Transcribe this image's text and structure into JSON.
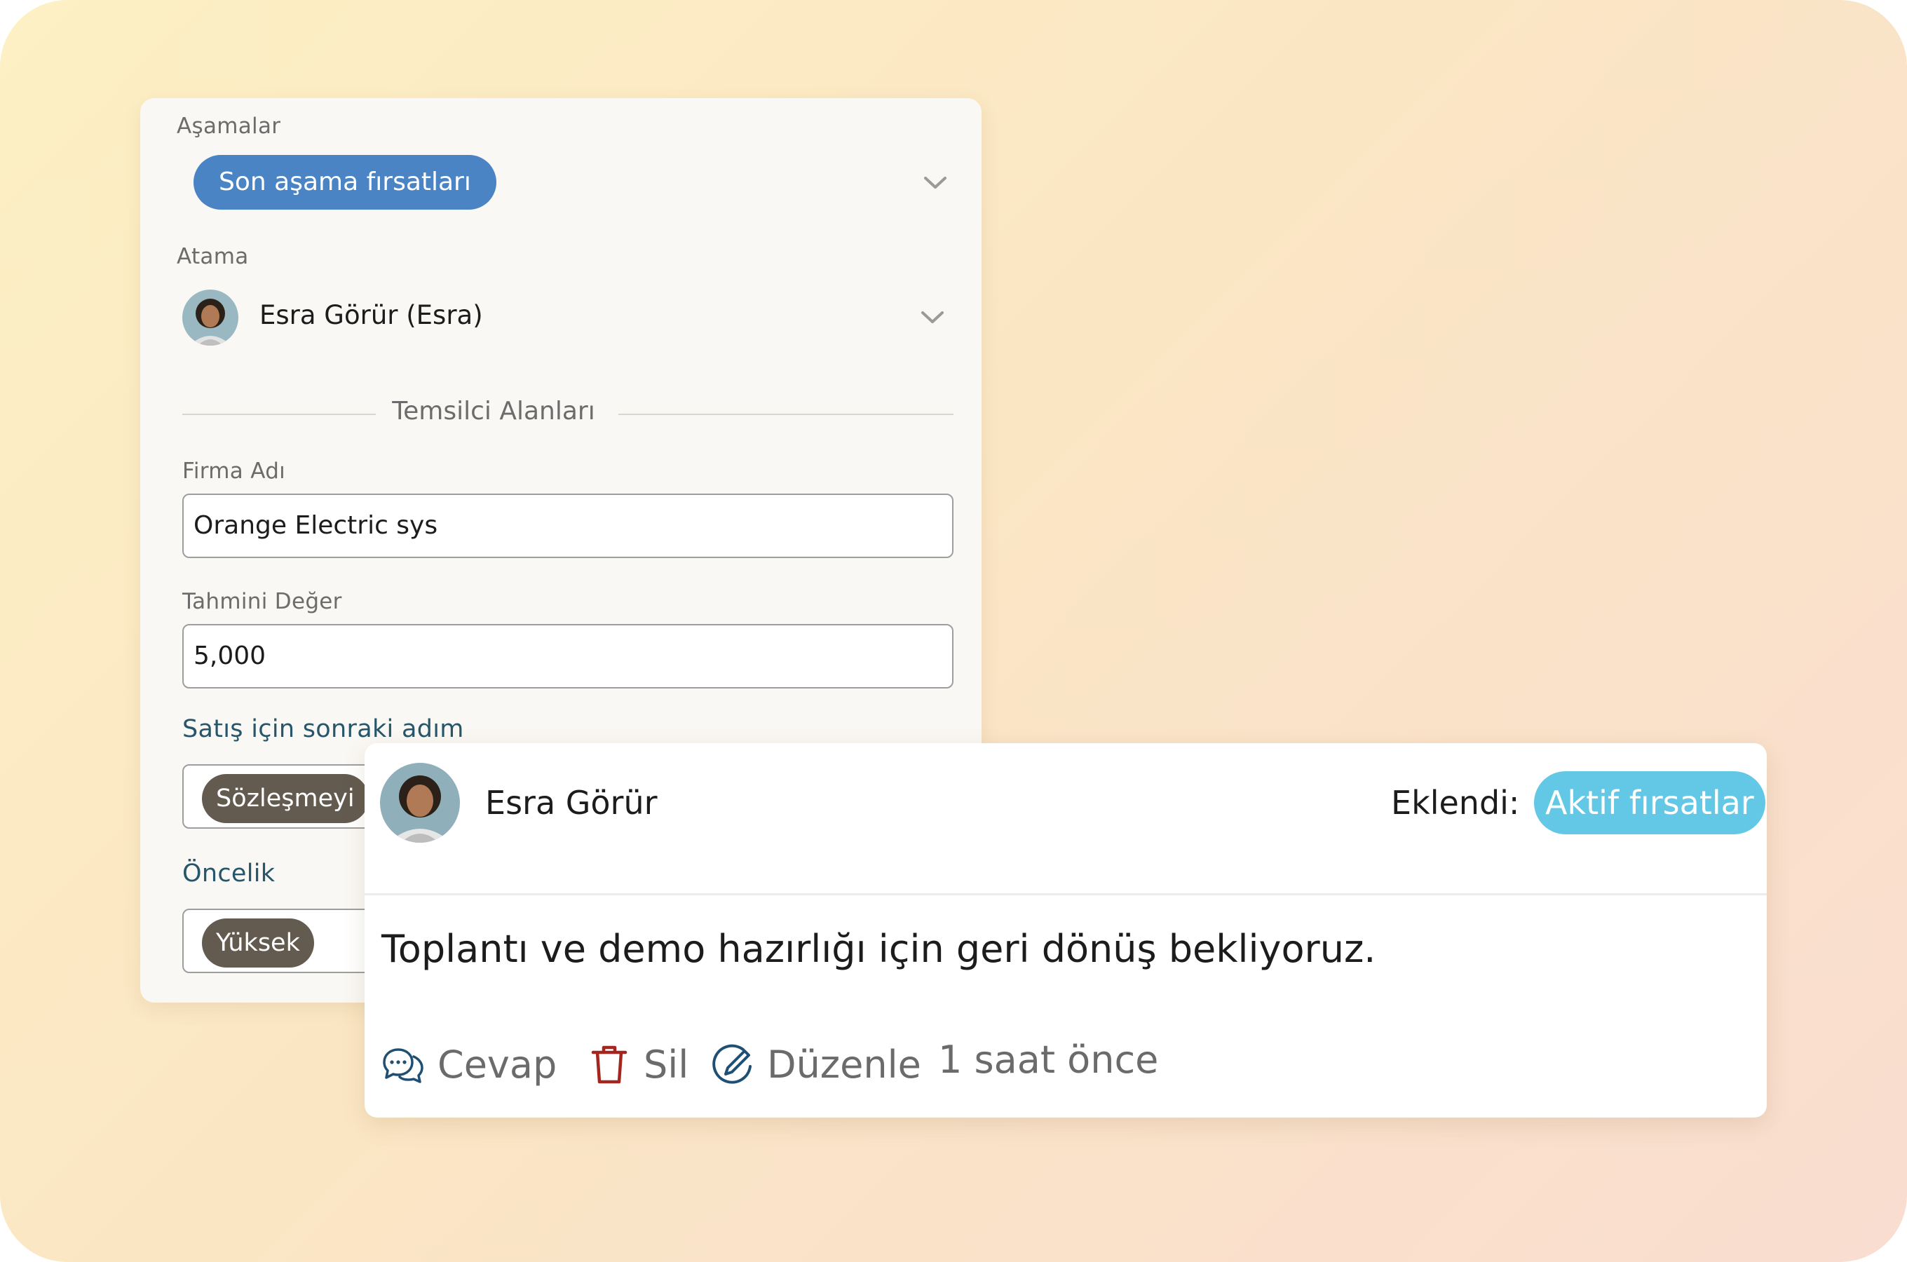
{
  "deal_panel": {
    "stages": {
      "label": "Aşamalar",
      "selected": "Son aşama fırsatları"
    },
    "assignment": {
      "label": "Atama",
      "assignee": "Esra Görür (Esra)"
    },
    "section_title": "Temsilci Alanları",
    "company": {
      "label": "Firma Adı",
      "value": "Orange Electric sys"
    },
    "estimated_value": {
      "label": "Tahmini Değer",
      "value": "5,000"
    },
    "next_step": {
      "label": "Satış için sonraki adım",
      "value": "Sözleşmeyi"
    },
    "priority": {
      "label": "Öncelik",
      "value": "Yüksek"
    }
  },
  "comment_card": {
    "author": "Esra Görür",
    "added_label": "Eklendi:",
    "added_to": "Aktif fırsatlar",
    "text": "Toplantı ve demo hazırlığı için geri dönüş bekliyoruz.",
    "actions": {
      "reply": "Cevap",
      "delete": "Sil",
      "edit": "Düzenle"
    },
    "timestamp": "1 saat önce"
  },
  "colors": {
    "stage_pill": "#4a84c4",
    "added_pill": "#62c8e6",
    "dark_chip": "#635a50",
    "delete_icon": "#a3261f",
    "reply_icon": "#1f4f73",
    "edit_icon": "#1f4f73",
    "teal_label": "#27566a"
  },
  "icons": {
    "stages_dropdown": "chevron-down-icon",
    "assignment_dropdown": "chevron-down-icon",
    "reply": "chat-bubbles-icon",
    "delete": "trash-icon",
    "edit": "pencil-circle-icon"
  }
}
